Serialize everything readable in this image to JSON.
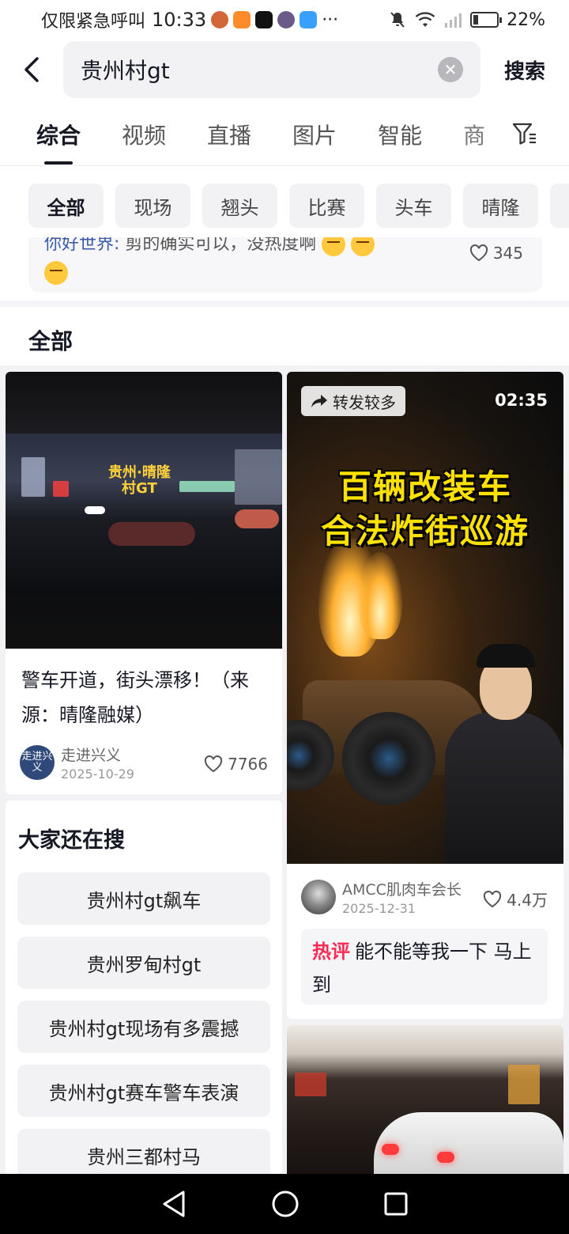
{
  "status_bar": {
    "carrier": "仅限紧急呼叫",
    "time": "10:33",
    "more": "···",
    "battery": "22%",
    "battery_level": 0.22
  },
  "search": {
    "query": "贵州村gt",
    "search_label": "搜索"
  },
  "tabs": [
    "综合",
    "视频",
    "直播",
    "图片",
    "智能",
    "商"
  ],
  "active_tab": "综合",
  "filter_chips": [
    "全部",
    "现场",
    "翘头",
    "比赛",
    "头车",
    "晴隆"
  ],
  "comment_peek": {
    "user": "你好世界:",
    "text": "剪的确实可以，没热度啊",
    "likes": "345"
  },
  "section_title": "全部",
  "cards": [
    {
      "thumb_caption_line1": "贵州·晴隆",
      "thumb_caption_line2": "村GT",
      "title": "警车开道，街头漂移！（来源：晴隆融媒）",
      "avatar_text": "走进兴义",
      "author": "走进兴义",
      "date": "2025-10-29",
      "likes": "7766"
    },
    {
      "badge": "转发较多",
      "duration": "02:35",
      "caption_line1": "百辆改装车",
      "caption_line2": "合法炸街巡游",
      "author": "AMCC肌肉车会长",
      "date": "2025-12-31",
      "likes": "4.4万",
      "hot_tag": "热评",
      "hot_comment": "能不能等我一下 马上到"
    }
  ],
  "related_search": {
    "title": "大家还在搜",
    "items": [
      "贵州村gt飙车",
      "贵州罗甸村gt",
      "贵州村gt现场有多震撼",
      "贵州村gt赛车警车表演",
      "贵州三都村马"
    ]
  },
  "colors": {
    "accent": "#fe2c55",
    "chip_bg": "#f2f2f4",
    "caption_yellow": "#ffe100"
  }
}
